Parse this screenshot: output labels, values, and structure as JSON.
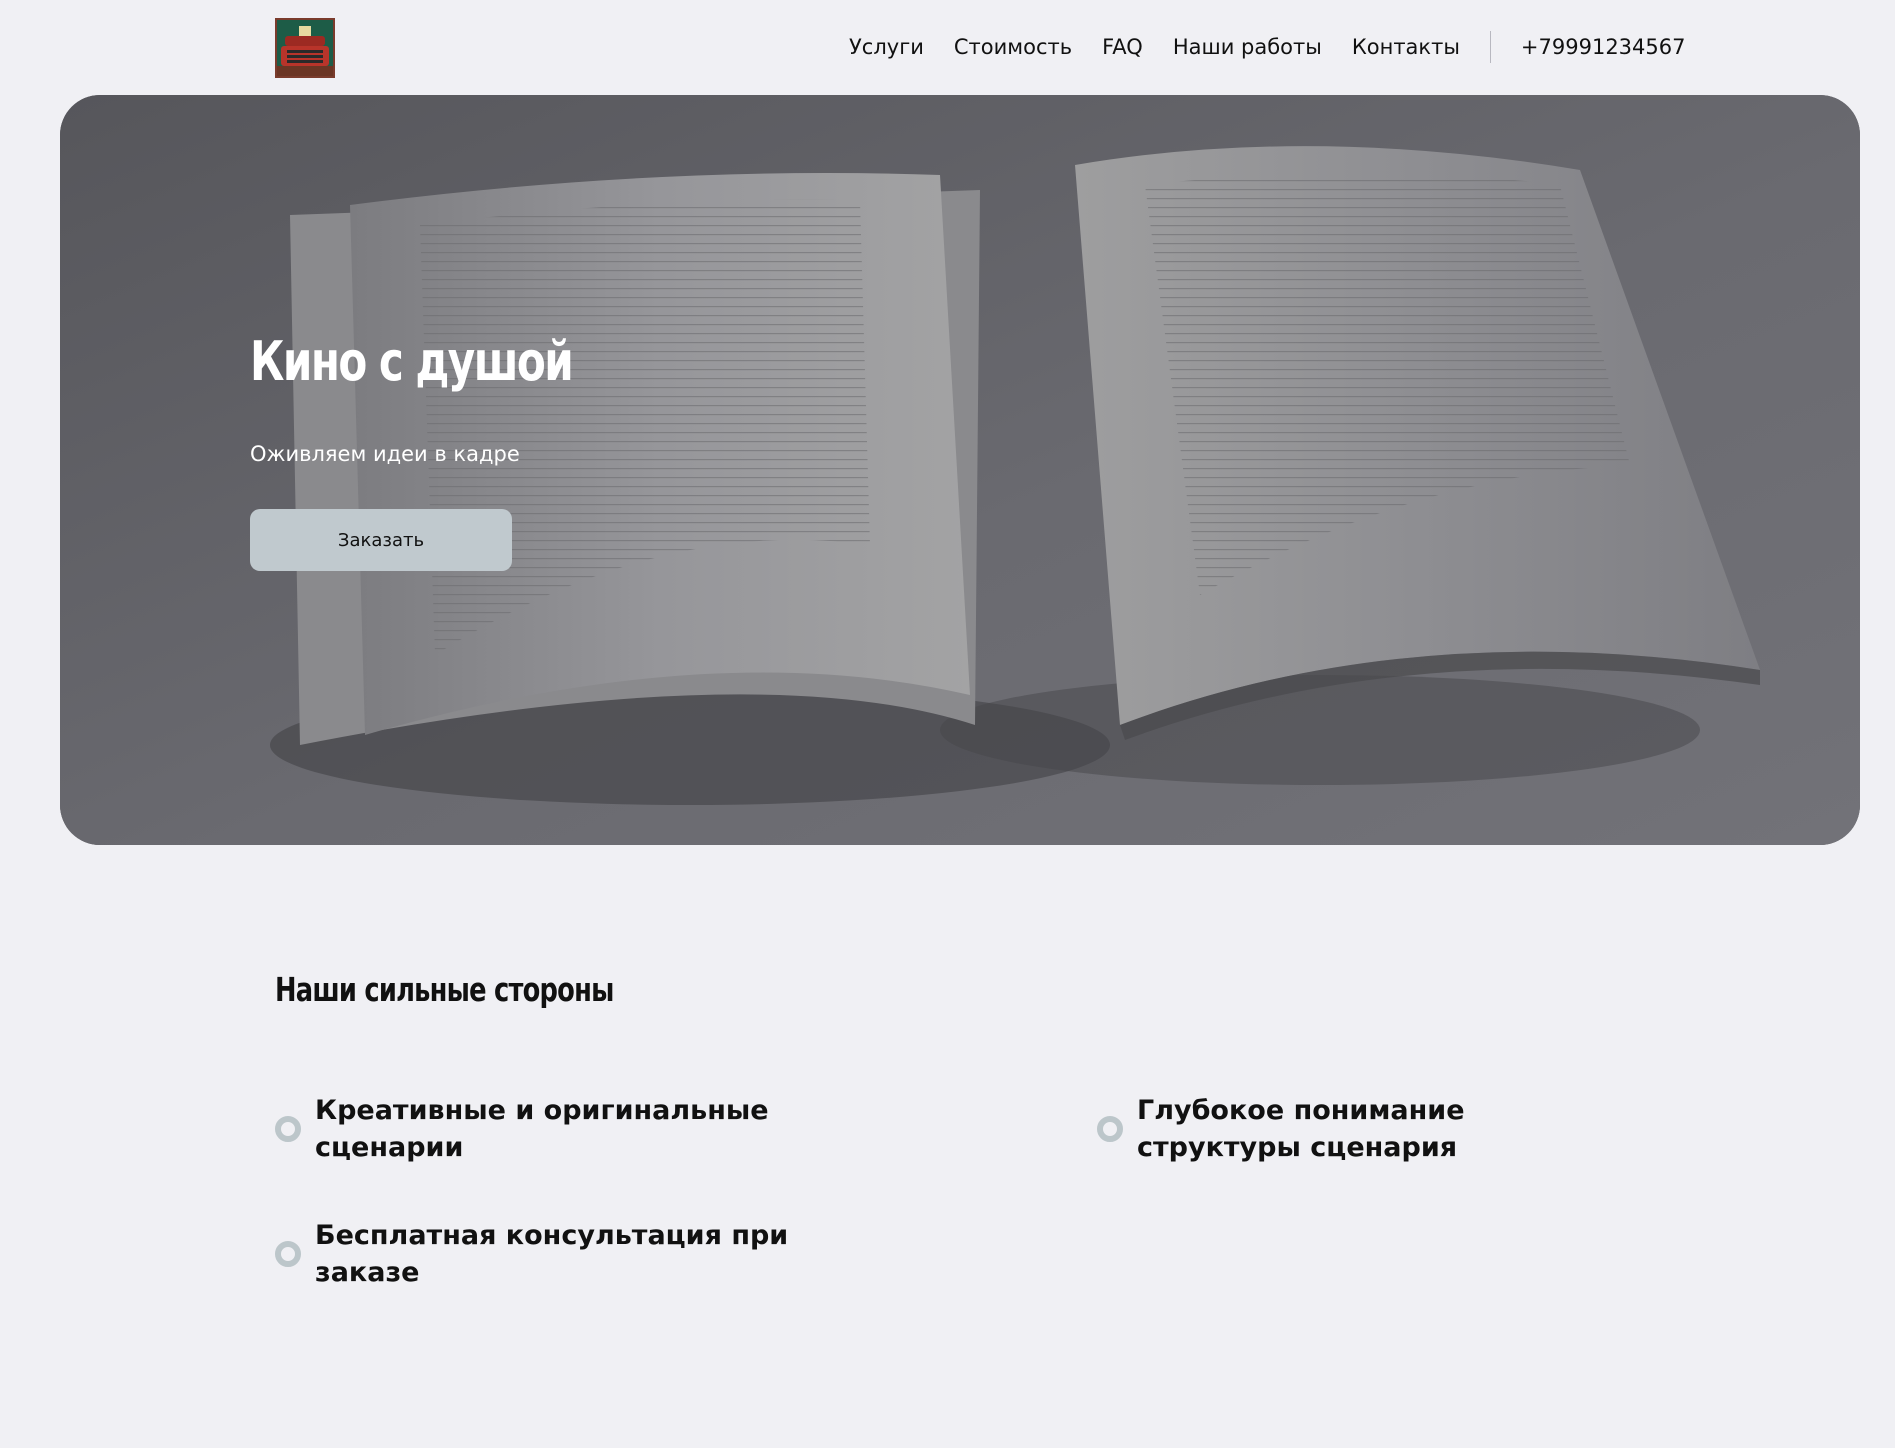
{
  "header": {
    "logo_icon": "typewriter-logo-icon",
    "nav": [
      {
        "label": "Услуги"
      },
      {
        "label": "Стоимость"
      },
      {
        "label": "FAQ"
      },
      {
        "label": "Наши работы"
      },
      {
        "label": "Контакты"
      }
    ],
    "phone": "+79991234567"
  },
  "hero": {
    "title": "Кино с душой",
    "subtitle": "Оживляем идеи в кадре",
    "order_button": "Заказать",
    "background_image": "open-book-photo"
  },
  "strengths": {
    "title": "Наши сильные стороны",
    "bullet_color": "#bcc6ca",
    "items": [
      {
        "text": "Креативные и оригинальные сценарии"
      },
      {
        "text": "Глубокое понимание структуры сценария"
      },
      {
        "text": "Бесплатная консультация при заказе"
      }
    ]
  },
  "colors": {
    "background": "#f0f0f4",
    "button": "#c0c9ce",
    "text": "#111111"
  }
}
